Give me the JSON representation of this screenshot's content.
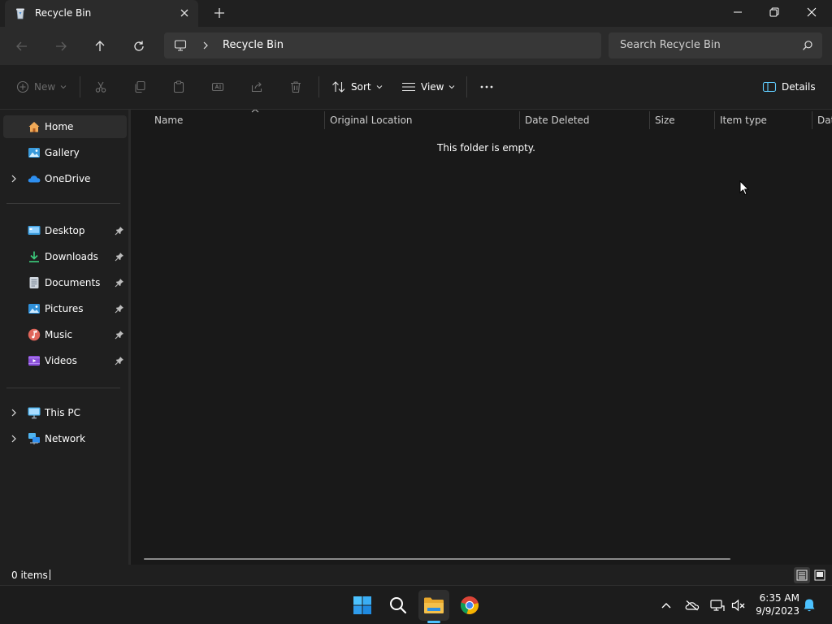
{
  "window": {
    "tab_title": "Recycle Bin"
  },
  "address": {
    "crumb": "Recycle Bin",
    "search_placeholder": "Search Recycle Bin"
  },
  "command_bar": {
    "new_label": "New",
    "sort_label": "Sort",
    "view_label": "View",
    "details_label": "Details"
  },
  "sidebar": {
    "items": [
      {
        "label": "Home",
        "icon": "home-icon",
        "selected": true
      },
      {
        "label": "Gallery",
        "icon": "gallery-icon"
      },
      {
        "label": "OneDrive",
        "icon": "onedrive-icon",
        "expandable": true
      },
      {
        "label": "Desktop",
        "icon": "desktop-icon",
        "pinned": true
      },
      {
        "label": "Downloads",
        "icon": "downloads-icon",
        "pinned": true
      },
      {
        "label": "Documents",
        "icon": "documents-icon",
        "pinned": true
      },
      {
        "label": "Pictures",
        "icon": "pictures-icon",
        "pinned": true
      },
      {
        "label": "Music",
        "icon": "music-icon",
        "pinned": true
      },
      {
        "label": "Videos",
        "icon": "videos-icon",
        "pinned": true
      },
      {
        "label": "This PC",
        "icon": "this-pc-icon",
        "expandable": true
      },
      {
        "label": "Network",
        "icon": "network-icon",
        "expandable": true
      }
    ]
  },
  "content": {
    "columns": [
      "Name",
      "Original Location",
      "Date Deleted",
      "Size",
      "Item type",
      "Dat"
    ],
    "sorted_column": "Name",
    "empty_message": "This folder is empty."
  },
  "status": {
    "item_count": "0 items"
  },
  "taskbar": {
    "apps": [
      "windows-start-icon",
      "search-icon",
      "file-explorer-icon",
      "chrome-icon"
    ],
    "time": "6:35 AM",
    "date": "9/9/2023"
  },
  "colors": {
    "accent": "#4cc2ff",
    "folder": "#f5c04a"
  }
}
